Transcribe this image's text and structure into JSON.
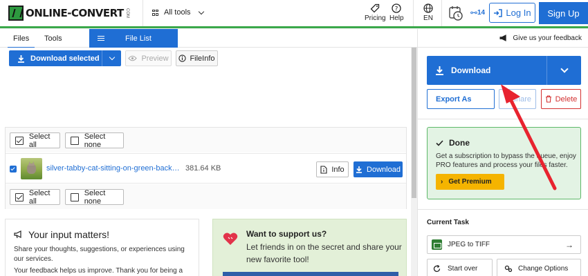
{
  "header": {
    "logo_text": "ONLINE-CONVERT",
    "logo_suffix": "COM",
    "all_tools": "All tools",
    "pricing": "Pricing",
    "help": "Help",
    "language": "EN",
    "points": "14",
    "login": "Log In",
    "signup": "Sign Up"
  },
  "tabs": {
    "files": "Files",
    "tools": "Tools",
    "file_list": "File List"
  },
  "toolbar": {
    "download_selected": "Download selected",
    "preview": "Preview",
    "fileinfo": "FileInfo"
  },
  "selection": {
    "select_all": "Select all",
    "select_none": "Select none"
  },
  "file": {
    "name": "silver-tabby-cat-sitting-on-green-backgroun...",
    "size": "381.64 KB",
    "info": "Info",
    "download": "Download"
  },
  "input_card": {
    "title": "Your input matters!",
    "text1": "Share your thoughts, suggestions, or experiences using our services.",
    "text2": "Your feedback helps us improve. Thank you for being a part"
  },
  "support_card": {
    "title": "Want to support us?",
    "text": "Let friends in on the secret and share your new favorite tool!"
  },
  "right": {
    "feedback": "Give us your feedback",
    "download": "Download",
    "export_as": "Export As",
    "share": "Share",
    "delete": "Delete",
    "done_title": "Done",
    "done_text": "Get a subscription to bypass the queue, enjoy PRO features and process your files faster.",
    "premium": "Get Premium",
    "current_task_label": "Current Task",
    "task": "JPEG to TIFF",
    "start_over": "Start over",
    "change_options": "Change Options"
  },
  "colors": {
    "primary": "#1f6ed4",
    "success": "#3aa84a",
    "danger": "#d32f2f",
    "premium": "#f5b400",
    "annotation": "#e8232f"
  }
}
